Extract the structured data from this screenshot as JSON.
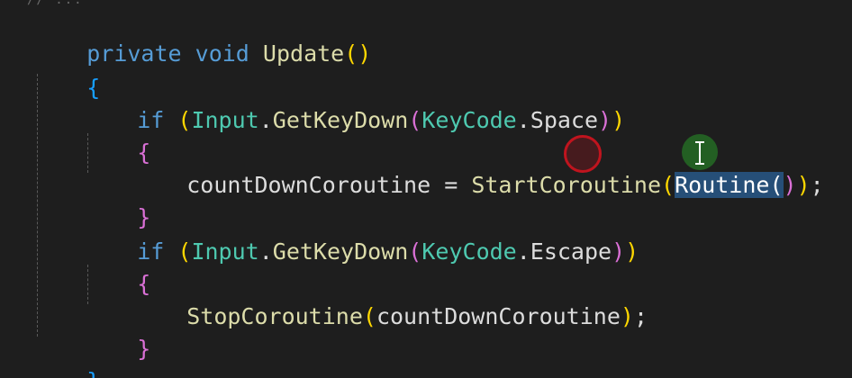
{
  "editor": {
    "header_comment": "// ... ",
    "tokens": {
      "private": "private",
      "void": "void",
      "update": "Update",
      "if": "if",
      "input": "Input",
      "dot": ".",
      "get_key_down": "GetKeyDown",
      "keycode": "KeyCode",
      "space": "Space",
      "escape": "Escape",
      "open_paren": "(",
      "close_paren": ")",
      "open_brace": "{",
      "close_brace": "}",
      "space_char": " ",
      "count_down_coroutine": "countDownCoroutine",
      "assign": " = ",
      "start_coroutine": "StartCoroutine",
      "routine": "Routine",
      "semicolon": ";",
      "stop_coroutine": "StopCoroutine"
    }
  }
}
